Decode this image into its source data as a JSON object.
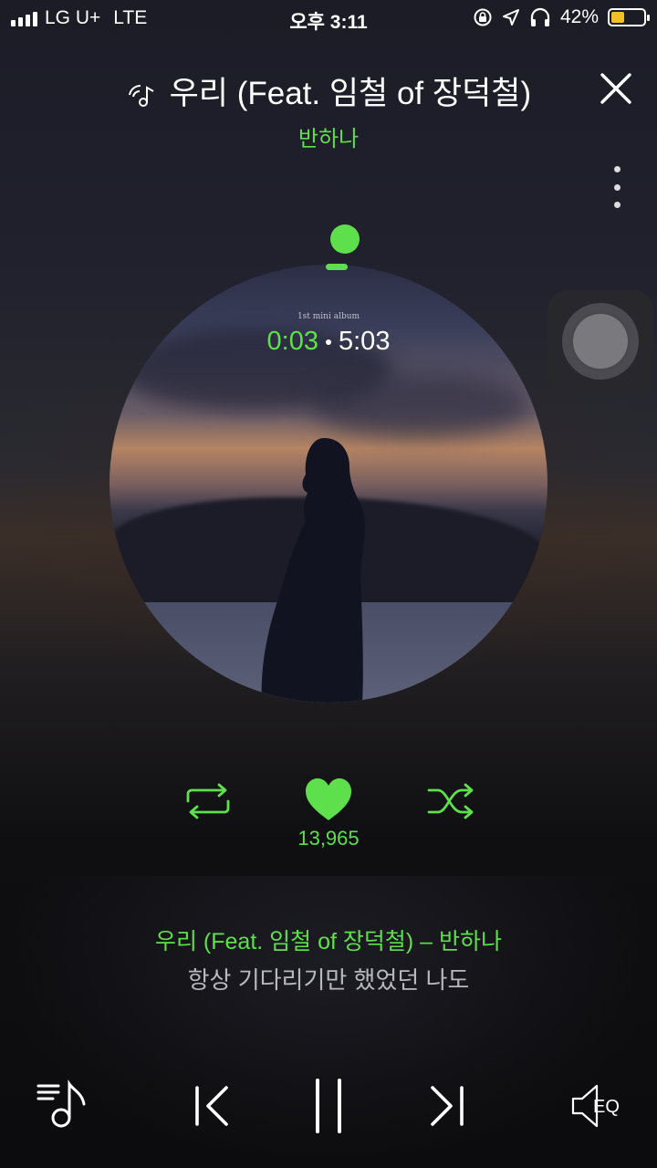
{
  "status_bar": {
    "carrier": "LG U+",
    "network": "LTE",
    "time": "오후 3:11",
    "battery_percent": "42%",
    "battery_level": 0.42,
    "icons": [
      "signal-icon",
      "orientation-lock-icon",
      "location-icon",
      "headphones-icon",
      "battery-icon"
    ]
  },
  "player": {
    "title": "우리 (Feat. 임철 of 장덕철)",
    "artist": "반하나",
    "album_label": "1st mini album",
    "time_current": "0:03",
    "time_total": "5:03",
    "progress": 0.01,
    "like_count": "13,965",
    "liked": true
  },
  "lyrics": {
    "header": "우리 (Feat. 임철 of 장덕철) – 반하나",
    "line": "항상 기다리기만 했었던 나도"
  },
  "controls": {
    "eq_label": "EQ",
    "icons": [
      "playlist-icon",
      "previous-icon",
      "pause-icon",
      "next-icon",
      "equalizer-icon",
      "repeat-icon",
      "heart-icon",
      "shuffle-icon",
      "close-icon",
      "more-icon",
      "music-note-icon"
    ]
  },
  "colors": {
    "accent": "#5ee04c",
    "text": "#ffffff",
    "lyric_inactive": "#b9b9bd",
    "battery": "#f5c026"
  }
}
